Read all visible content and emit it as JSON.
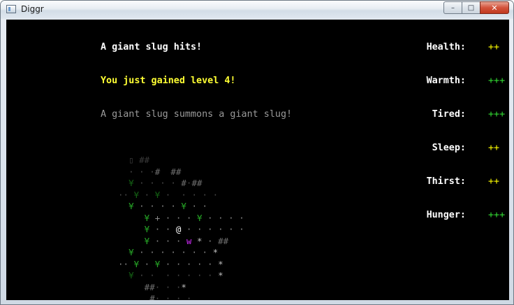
{
  "window": {
    "title": "Diggr",
    "minimize_label": "–",
    "maximize_label": "□",
    "close_label": "✕"
  },
  "messages": [
    {
      "text": "A giant slug hits!",
      "color": "#ffffff"
    },
    {
      "text": "You just gained level 4!",
      "color": "#ffff33"
    },
    {
      "text": "A giant slug summons a giant slug!",
      "color": "#9a9a9a"
    }
  ],
  "stats": [
    {
      "label": "Health:",
      "value": "++",
      "color": "#ffff00"
    },
    {
      "label": "Warmth:",
      "value": "+++",
      "color": "#33dd33"
    },
    {
      "label": "Tired:",
      "value": "+++",
      "color": "#33dd33"
    },
    {
      "label": "Sleep:",
      "value": "++",
      "color": "#ffff00"
    },
    {
      "label": "Thirst:",
      "value": "++",
      "color": "#ffff00"
    },
    {
      "label": "Hunger:",
      "value": "+++",
      "color": "#33dd33"
    }
  ],
  "map": {
    "rows": [
      "  ▯ ##",
      "  · · ·#  ##",
      "  ¥ · · · · #·##",
      "·· ¥ · ¥ ·  · · · ·",
      "  ¥ · · · · ¥ · ·",
      "     ¥ + · · · ¥ · · · ·",
      "     ¥ · · @ · · · · · ·",
      "     ¥ · · · w * · ##",
      "  ¥ · · · · · · · *",
      "·· ¥ · ¥ · · · · · *",
      "  ¥ · ·  · · · · · *",
      "     ##· · ·*",
      "      #· · · ·"
    ],
    "player_glyph": "@",
    "monster_glyph": "w",
    "monster_name": "giant slug"
  }
}
